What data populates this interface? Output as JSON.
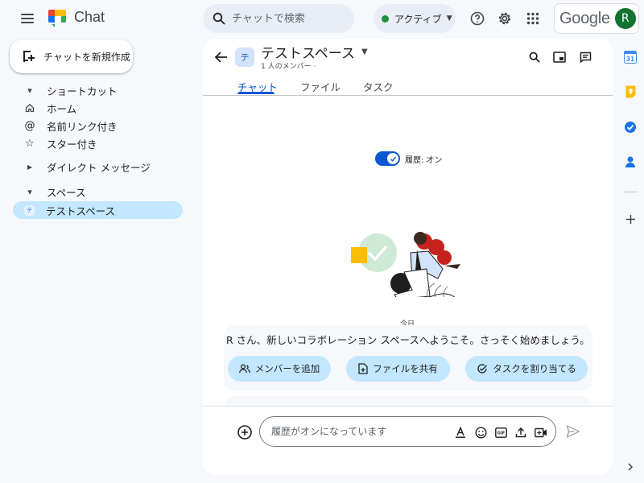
{
  "app": {
    "title": "Chat",
    "google_word": "Google",
    "avatar_initial": "R"
  },
  "search": {
    "placeholder": "チャットで検索"
  },
  "status": {
    "label": "アクティブ",
    "color": "#1e8e3e"
  },
  "topbar_icons": [
    "help-icon",
    "settings-icon",
    "apps-grid-icon"
  ],
  "sidebar": {
    "new_chat_label": "チャットを新規作成",
    "shortcuts_label": "ショートカット",
    "shortcut_items": [
      {
        "label": "ホーム",
        "icon": "home-icon"
      },
      {
        "label": "名前リンク付き",
        "icon": "at-mention-icon"
      },
      {
        "label": "スター付き",
        "icon": "star-icon"
      }
    ],
    "direct_messages_label": "ダイレクト メッセージ",
    "spaces_label": "スペース",
    "space_items": [
      {
        "label": "テストスペース",
        "avatar": "テ",
        "selected": true
      }
    ]
  },
  "space": {
    "avatar": "テ",
    "title": "テストスペース",
    "member_count": "1 人のメンバー",
    "tabs": [
      "チャット",
      "ファイル",
      "タスク"
    ],
    "active_tab": "チャット"
  },
  "history": {
    "label": "履歴: オン",
    "enabled": true
  },
  "date_label": "今日",
  "welcome": {
    "text": "R さん、新しいコラボレーション スペースへようこそ。さっそく始めましょう。",
    "actions": [
      {
        "label": "メンバーを追加",
        "icon": "add-people-icon"
      },
      {
        "label": "ファイルを共有",
        "icon": "file-icon"
      },
      {
        "label": "タスクを割り当てる",
        "icon": "task-icon"
      }
    ]
  },
  "composer": {
    "placeholder": "履歴がオンになっています"
  },
  "colors": {
    "accent": "#0b57d0",
    "selected_bg": "#c2e7ff",
    "page_bg": "#f6f8fc"
  }
}
